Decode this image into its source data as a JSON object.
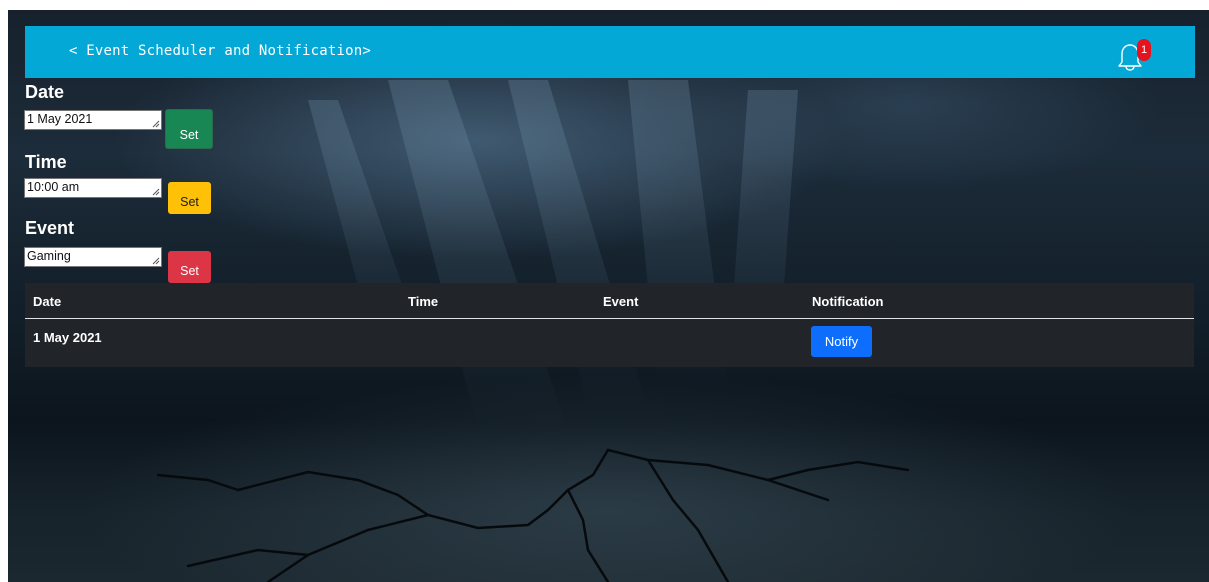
{
  "header": {
    "title": "< Event Scheduler and Notification>",
    "notification_count": "1"
  },
  "form": {
    "date": {
      "label": "Date",
      "value": "1 May 2021",
      "button": "Set"
    },
    "time": {
      "label": "Time",
      "value": "10:00 am",
      "button": "Set"
    },
    "event": {
      "label": "Event",
      "value": "Gaming",
      "button": "Set"
    }
  },
  "table": {
    "headers": [
      "Date",
      "Time",
      "Event",
      "Notification"
    ],
    "rows": [
      {
        "date": "1 May 2021",
        "time": "",
        "event": "",
        "action": "Notify"
      }
    ]
  },
  "colors": {
    "header_bg": "#04a8d6",
    "set_date": "#198754",
    "set_time": "#ffc107",
    "set_event": "#dc3545",
    "notify": "#0d6efd",
    "table_bg": "#212529",
    "badge": "#e8121f"
  },
  "icons": {
    "notification": "bell-icon"
  }
}
